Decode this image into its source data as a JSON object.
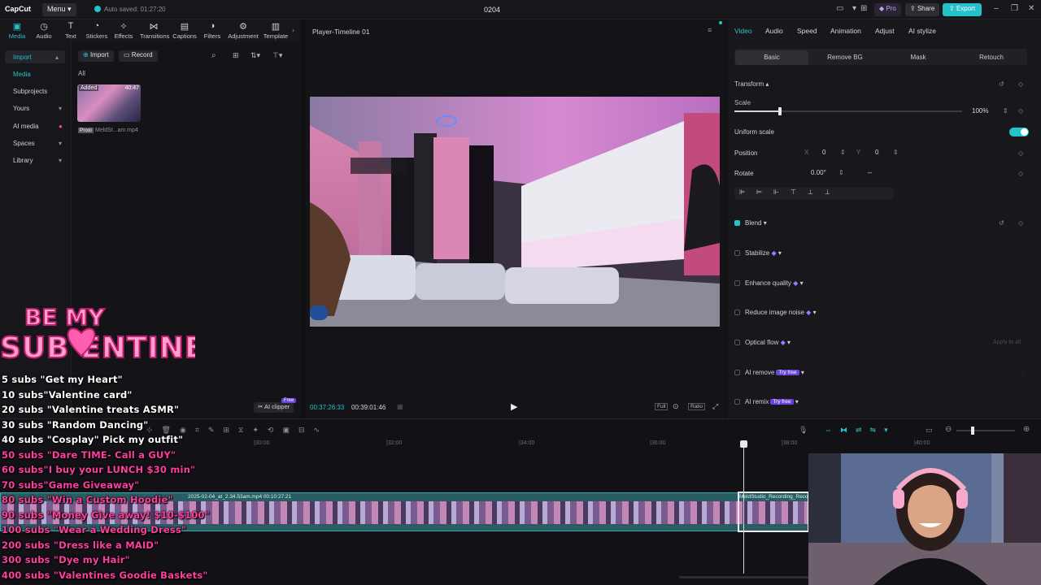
{
  "app": {
    "logo": "CapCut",
    "menu_label": "Menu",
    "autosave": "Auto saved: 01:27:20",
    "project_name": "0204",
    "pro_label": "Pro",
    "share_label": "Share",
    "export_label": "Export"
  },
  "toolbar": {
    "items": [
      "Media",
      "Audio",
      "Text",
      "Stickers",
      "Effects",
      "Transitions",
      "Captions",
      "Filters",
      "Adjustment",
      "Template"
    ]
  },
  "leftnav": {
    "items": [
      "Import",
      "Media",
      "Subprojects",
      "Yours",
      "AI media",
      "Spaces",
      "Library"
    ]
  },
  "media": {
    "import_label": "Import",
    "record_label": "Record",
    "filter_all": "All",
    "clip_badge": "Added",
    "clip_duration": "40:47",
    "clip_proxy": "Proxi",
    "clip_name": "MeldSt...am.mp4"
  },
  "player": {
    "title": "Player-Timeline 01",
    "current_time": "00:37:26:33",
    "total_time": "00:39:01:46",
    "ai_clipper": "AI clipper",
    "ai_clipper_badge": "Free",
    "full_label": "Full",
    "ratio_label": "Ratio"
  },
  "props": {
    "tabs": [
      "Video",
      "Audio",
      "Speed",
      "Animation",
      "Adjust",
      "AI stylize"
    ],
    "subtabs": [
      "Basic",
      "Remove BG",
      "Mask",
      "Retouch"
    ],
    "transform_label": "Transform",
    "scale_label": "Scale",
    "scale_value": "100%",
    "scale_fraction": 0.2,
    "uniform_scale": "Uniform scale",
    "position_label": "Position",
    "pos_x_label": "X",
    "pos_x": "0",
    "pos_y_label": "Y",
    "pos_y": "0",
    "rotate_label": "Rotate",
    "rotate_value": "0.00°",
    "blend_label": "Blend",
    "stabilize_label": "Stabilize",
    "enhance_label": "Enhance quality",
    "noise_label": "Reduce image noise",
    "optical_label": "Optical flow",
    "apply_all": "Apply to all",
    "ai_remove_label": "AI remove",
    "ai_remix_label": "AI remix",
    "try_free": "Try free"
  },
  "timeline": {
    "ruler_labels": [
      "|30:00",
      "|32:00",
      "|34:00",
      "|36:00",
      "|38:00",
      "|40:00"
    ],
    "clip1_label": "2025-02-04_at_2.34.53am.mp4  00:10:27:21",
    "clip2_label": "MeldStudio_Recording_Reco"
  },
  "overlay": {
    "logo_top": "BE MY",
    "logo_bottom": "SUB ENTINE",
    "lines": [
      {
        "text": "5 subs \"Get my Heart\"",
        "color": "white"
      },
      {
        "text": "10 subs\"Valentine card\"",
        "color": "white"
      },
      {
        "text": "20 subs \"Valentine treats ASMR\"",
        "color": "white"
      },
      {
        "text": "30 subs \"Random Dancing\"",
        "color": "white"
      },
      {
        "text": "40 subs \"Cosplay\" Pick my outfit\"",
        "color": "white"
      },
      {
        "text": "50 subs \"Dare TIME- Call a GUY\"",
        "color": "pink"
      },
      {
        "text": "60 subs\"I buy your LUNCH $30 min\"",
        "color": "pink"
      },
      {
        "text": "70 subs\"Game Giveaway\"",
        "color": "pink"
      },
      {
        "text": "80 subs \"Win a Custom Hoodie\"",
        "color": "pink"
      },
      {
        "text": "90 subs \"Money Give away! $10-$100\"",
        "color": "pink"
      },
      {
        "text": "100 subs \"Wear a Wedding Dress\"",
        "color": "pink"
      },
      {
        "text": "200 subs \"Dress like a MAID\"",
        "color": "pink"
      },
      {
        "text": "300 subs \"Dye my Hair\"",
        "color": "pink"
      },
      {
        "text": "400 subs \"Valentines Goodie Baskets\"",
        "color": "pink"
      }
    ]
  },
  "colors": {
    "accent": "#25c2c9",
    "pink": "#ff3f9f",
    "pro_purple": "#6b45d9"
  }
}
